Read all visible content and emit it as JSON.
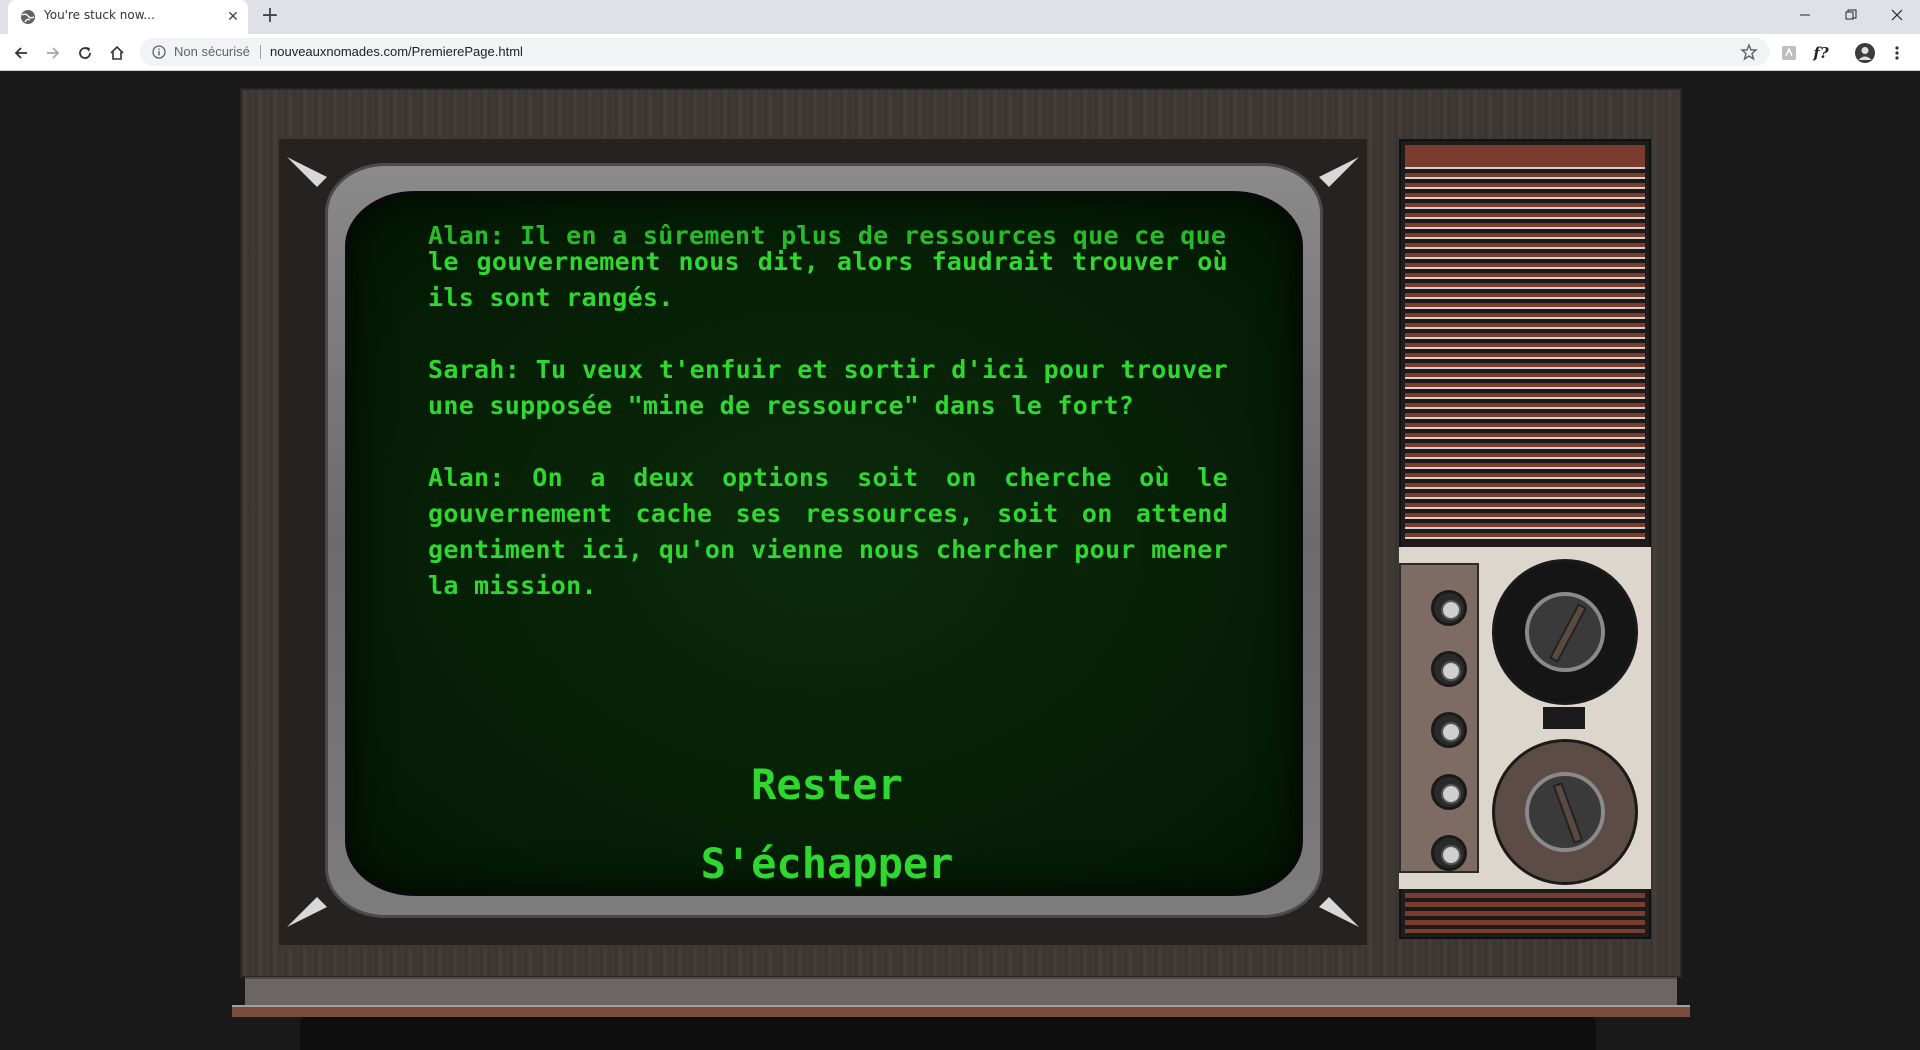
{
  "browser": {
    "tab": {
      "title": "You're stuck now..."
    },
    "new_tab_label": "+",
    "close_tab_label": "✕",
    "address": {
      "security": "Non sécurisé",
      "url": "nouveauxnomades.com/PremierePage.html"
    },
    "extension_label": "f?"
  },
  "game": {
    "cut_line": "Alan: Il en a sûrement plus de ressources que ce que",
    "paragraphs": [
      "le gouvernement nous dit, alors faudrait trouver où ils sont rangés.",
      "Sarah: Tu veux t'enfuir et sortir d'ici pour trouver une supposée \"mine de ressource\" dans le fort?",
      "Alan: On a deux options soit on cherche où le gouvernement cache ses ressources, soit on attend gentiment ici, qu'on vienne nous chercher pour mener la mission."
    ],
    "choices": [
      "Rester",
      "S'échapper"
    ]
  },
  "colors": {
    "screen_text": "#2ed82e",
    "screen_bg": "#062006",
    "cabinet": "#3e3936",
    "wood_trim": "#7b3c30"
  }
}
